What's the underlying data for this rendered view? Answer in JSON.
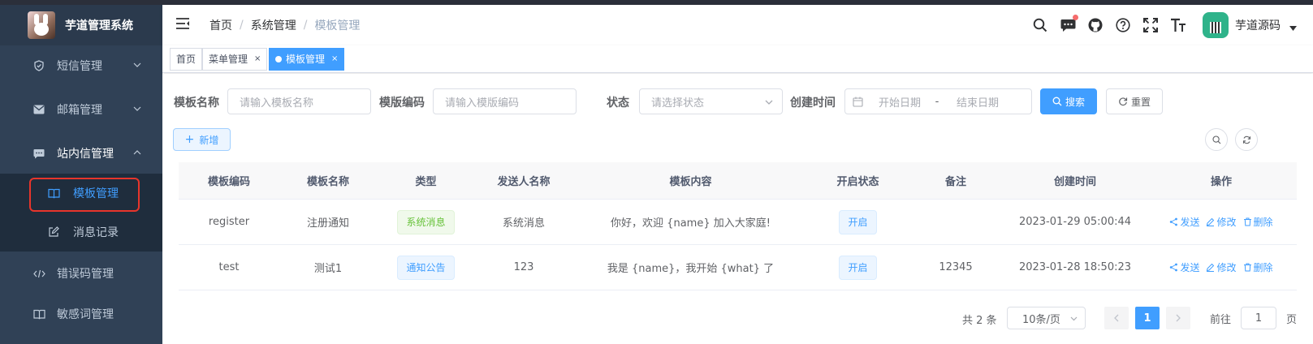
{
  "app": {
    "title": "芋道管理系统"
  },
  "sidebar": {
    "items": [
      {
        "label": "短信管理",
        "icon": "shield-check-icon"
      },
      {
        "label": "邮箱管理",
        "icon": "mail-icon"
      },
      {
        "label": "站内信管理",
        "icon": "chat-icon"
      },
      {
        "label": "模板管理",
        "icon": "book-icon"
      },
      {
        "label": "消息记录",
        "icon": "edit-icon"
      },
      {
        "label": "错误码管理",
        "icon": "code-icon"
      },
      {
        "label": "敏感词管理",
        "icon": "book-icon"
      }
    ]
  },
  "header": {
    "breadcrumb": [
      "首页",
      "系统管理",
      "模板管理"
    ],
    "user_name": "芋道源码"
  },
  "tags": [
    {
      "label": "首页"
    },
    {
      "label": "菜单管理"
    },
    {
      "label": "模板管理"
    }
  ],
  "search": {
    "name_label": "模板名称",
    "name_placeholder": "请输入模板名称",
    "code_label": "模版编码",
    "code_placeholder": "请输入模版编码",
    "status_label": "状态",
    "status_placeholder": "请选择状态",
    "time_label": "创建时间",
    "start_placeholder": "开始日期",
    "range_separator": "-",
    "end_placeholder": "结束日期",
    "search_button": "搜索",
    "reset_button": "重置"
  },
  "toolbar": {
    "add_button": "新增"
  },
  "table": {
    "columns": [
      "模板编码",
      "模板名称",
      "类型",
      "发送人名称",
      "模板内容",
      "开启状态",
      "备注",
      "创建时间",
      "操作"
    ],
    "rows": [
      {
        "code": "register",
        "name": "注册通知",
        "type": "系统消息",
        "sender": "系统消息",
        "content": "你好，欢迎 {name} 加入大家庭!",
        "status": "开启",
        "remark": "",
        "created": "2023-01-29 05:00:44"
      },
      {
        "code": "test",
        "name": "测试1",
        "type": "通知公告",
        "sender": "123",
        "content": "我是 {name}，我开始 {what} 了",
        "status": "开启",
        "remark": "12345",
        "created": "2023-01-28 18:50:23"
      }
    ],
    "actions": {
      "send": "发送",
      "edit": "修改",
      "delete": "删除"
    }
  },
  "pagination": {
    "total": "共 2 条",
    "page_size": "10条/页",
    "current_page": "1",
    "goto_label": "前往",
    "goto_value": "1",
    "goto_suffix": "页"
  },
  "colors": {
    "sidebar_bg": "#304156",
    "primary": "#409eff",
    "highlight_box": "#e8352b",
    "success": "#67c23a"
  }
}
